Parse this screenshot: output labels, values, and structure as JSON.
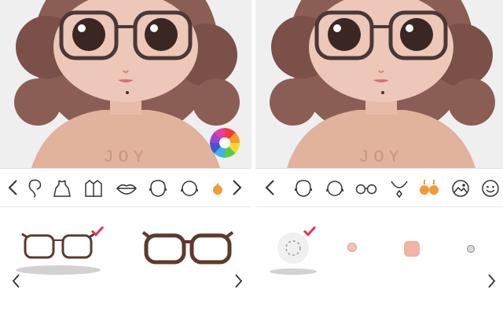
{
  "left_panel": {
    "shirt_text": "JOY",
    "categories": [
      "hair-icon",
      "dress-icon",
      "jacket-icon",
      "lips-icon",
      "head-icon",
      "face-icon",
      "accessory-icon"
    ],
    "options": [
      {
        "name": "glasses-thin-frame",
        "selected": true
      },
      {
        "name": "glasses-thick-frame",
        "selected": false
      }
    ]
  },
  "right_panel": {
    "shirt_text": "JOY",
    "categories": [
      "head-icon",
      "face-icon",
      "glasses-icon",
      "necklace-icon",
      "earrings-icon",
      "background-icon",
      "emoji-icon"
    ],
    "options": [
      {
        "name": "none-option",
        "selected": true
      },
      {
        "name": "small-stud",
        "selected": false
      },
      {
        "name": "square-stud",
        "selected": false
      },
      {
        "name": "crystal-stud",
        "selected": false
      }
    ]
  },
  "colors": {
    "accent": "#f29a3a",
    "check": "#e8344f",
    "shirt": "#e3b7a0",
    "hair": "#8f6256",
    "skin": "#ecc6b6"
  }
}
